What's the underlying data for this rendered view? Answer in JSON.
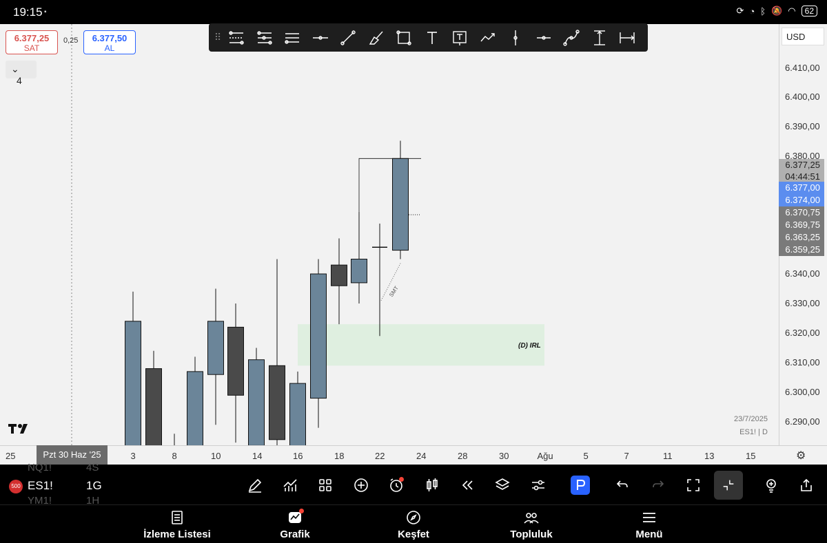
{
  "status_bar": {
    "time": "19:15",
    "battery": "62"
  },
  "quote": {
    "sell_price": "6.377,25",
    "sell_label": "SAT",
    "spread": "0,25",
    "buy_price": "6.377,50",
    "buy_label": "AL",
    "collapse_count": "4"
  },
  "currency": "USD",
  "price_axis": {
    "labels": [
      "6.410,00",
      "6.400,00",
      "6.390,00",
      "6.380,00",
      "6.340,00",
      "6.330,00",
      "6.320,00",
      "6.310,00",
      "6.300,00",
      "6.290,00"
    ],
    "tags": [
      {
        "text": "6.377,25",
        "color": "#b0b0b0",
        "dark_text": true
      },
      {
        "text": "04:44:51",
        "color": "#b0b0b0",
        "dark_text": true
      },
      {
        "text": "6.377,00",
        "color": "#5b8def"
      },
      {
        "text": "6.374,00",
        "color": "#5b8def"
      },
      {
        "text": "6.370,75",
        "color": "#7a7a7a"
      },
      {
        "text": "6.369,75",
        "color": "#7a7a7a"
      },
      {
        "text": "6.363,25",
        "color": "#7a7a7a"
      },
      {
        "text": "6.359,25",
        "color": "#7a7a7a"
      }
    ]
  },
  "time_axis": {
    "labels": [
      "25",
      "3",
      "8",
      "10",
      "14",
      "16",
      "18",
      "22",
      "24",
      "28",
      "30",
      "Ağu",
      "5",
      "7",
      "11",
      "13",
      "15"
    ],
    "crosshair_label": "Pzt 30 Haz '25"
  },
  "chart_data": {
    "type": "candlestick",
    "symbol": "ES1!",
    "interval": "D",
    "ylim": [
      6283,
      6418
    ],
    "candles": [
      {
        "x": "3",
        "open": 6281,
        "high": 6334,
        "low": 6281,
        "close": 6324,
        "dir": "up"
      },
      {
        "x": "7",
        "open": 6308,
        "high": 6314,
        "low": 6281,
        "close": 6281,
        "dir": "down"
      },
      {
        "x": "8",
        "open": 6281,
        "high": 6286,
        "low": 6281,
        "close": 6281,
        "dir": "up"
      },
      {
        "x": "9",
        "open": 6281,
        "high": 6312,
        "low": 6281,
        "close": 6307,
        "dir": "up"
      },
      {
        "x": "10",
        "open": 6306,
        "high": 6335,
        "low": 6289,
        "close": 6324,
        "dir": "up"
      },
      {
        "x": "11",
        "open": 6322,
        "high": 6330,
        "low": 6283,
        "close": 6299,
        "dir": "down"
      },
      {
        "x": "14",
        "open": 6282,
        "high": 6315,
        "low": 6281,
        "close": 6311,
        "dir": "up"
      },
      {
        "x": "15",
        "open": 6309,
        "high": 6345,
        "low": 6281,
        "close": 6284,
        "dir": "down"
      },
      {
        "x": "16",
        "open": 6281,
        "high": 6307,
        "low": 6281,
        "close": 6303,
        "dir": "up"
      },
      {
        "x": "17",
        "open": 6298,
        "high": 6345,
        "low": 6288,
        "close": 6340,
        "dir": "up"
      },
      {
        "x": "18",
        "open": 6343,
        "high": 6352,
        "low": 6323,
        "close": 6336,
        "dir": "down"
      },
      {
        "x": "21",
        "open": 6337,
        "high": 6361,
        "low": 6330,
        "close": 6345,
        "dir": "up"
      },
      {
        "x": "22",
        "open": 6349,
        "high": 6357,
        "low": 6319,
        "close": 6349,
        "dir": "doji"
      },
      {
        "x": "23",
        "open": 6348,
        "high": 6385,
        "low": 6345,
        "close": 6379,
        "dir": "up"
      }
    ],
    "zone_label": "(D) IRL",
    "smt_label": "SMT",
    "date_label": "23/7/2025",
    "symbol_label": "ES1! | D"
  },
  "bottom_toolbar": {
    "badge": "500",
    "symbol": "ES1!",
    "interval": "1G",
    "ghost_above": "NQ1!",
    "ghost_above_int": "4S",
    "ghost_below": "YM1!",
    "ghost_below_int": "1H"
  },
  "bottom_nav": [
    {
      "label": "İzleme Listesi",
      "icon": "watchlist-icon"
    },
    {
      "label": "Grafik",
      "icon": "chart-icon"
    },
    {
      "label": "Keşfet",
      "icon": "compass-icon"
    },
    {
      "label": "Topluluk",
      "icon": "community-icon"
    },
    {
      "label": "Menü",
      "icon": "menu-icon"
    }
  ]
}
